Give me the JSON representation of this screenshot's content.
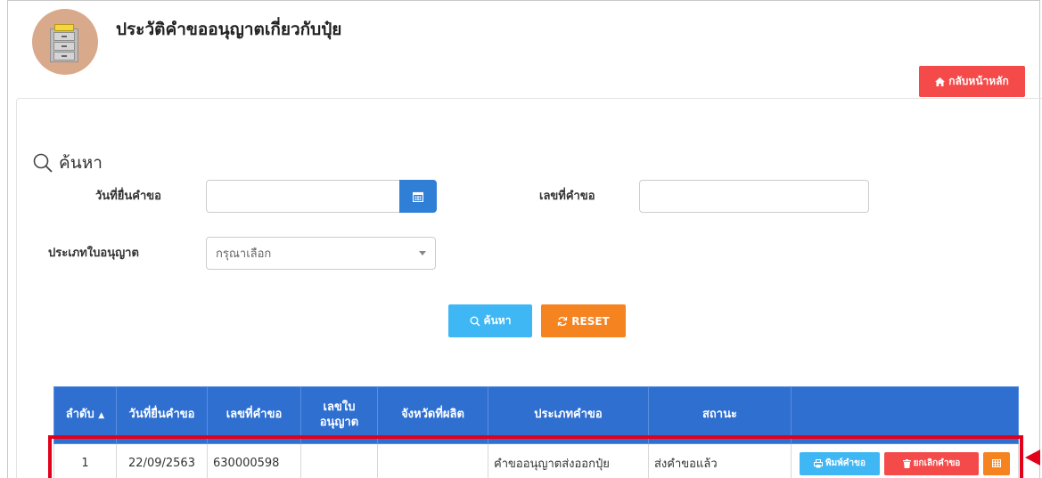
{
  "header": {
    "title": "ประวัติคำขออนุญาตเกี่ยวกับปุ๋ย",
    "icon": "file-cabinet-icon",
    "home_button_label": "กลับหน้าหลัก",
    "home_button_icon": "home-icon"
  },
  "search": {
    "heading": "ค้นหา",
    "heading_icon": "search-icon",
    "submit_date_label": "วันที่ยื่นคำขอ",
    "submit_date_value": "",
    "calendar_icon": "calendar-icon",
    "request_no_label": "เลขที่คำขอ",
    "request_no_value": "",
    "license_type_label": "ประเภทใบอนุญาต",
    "license_type_selected": "กรุณาเลือก",
    "search_button_label": "ค้นหา",
    "reset_button_label": "RESET"
  },
  "table": {
    "columns": [
      "ลำดับ",
      "วันที่ยื่นคำขอ",
      "เลขที่คำขอ",
      "เลขใบ อนุญาต",
      "จังหวัดที่ผลิต",
      "ประเภทคำขอ",
      "สถานะ",
      ""
    ],
    "sort_indicator": "▲",
    "rows": [
      {
        "no": "1",
        "submit_date": "22/09/2563",
        "request_no": "630000598",
        "license_no": "",
        "province": "",
        "request_type": "คำขออนุญาตส่งออกปุ๋ย",
        "status": "ส่งคำขอแล้ว",
        "actions": {
          "print_label": "พิมพ์คำขอ",
          "cancel_label": "ยกเลิกคำขอ"
        }
      }
    ]
  },
  "colors": {
    "primary": "#2f6fd0",
    "danger": "#f54a4a",
    "info": "#3fb7f5",
    "warning": "#f5831f",
    "highlight": "#e3001b"
  }
}
